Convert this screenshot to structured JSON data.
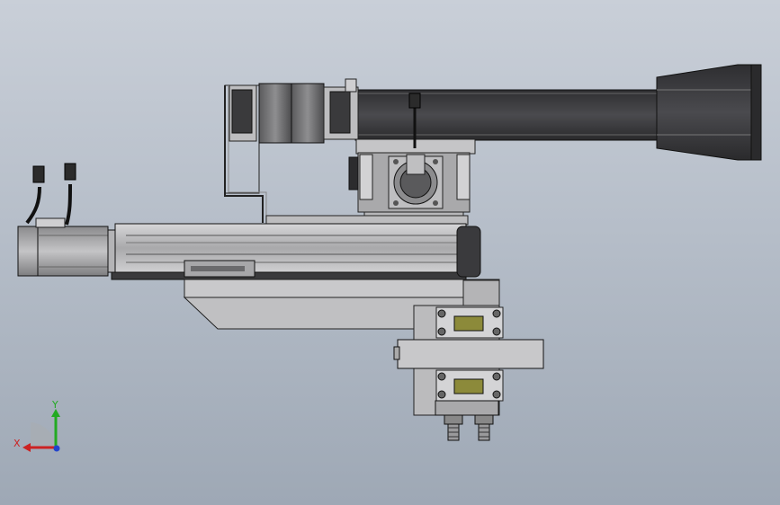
{
  "viewport": {
    "background_top": "#c9cfd8",
    "background_bottom": "#9ea8b5"
  },
  "colors": {
    "dark_beam": "#3a3a3d",
    "light_metal": "#c9c9cb",
    "mid_metal": "#9a9a9c",
    "outline": "#1a1a1a",
    "brass": "#8c8a3a",
    "cable": "#111111"
  },
  "parts": [
    "servo-motor-left",
    "linear-module-horizontal",
    "upper-beam-arm",
    "stepper-motor-top",
    "rotary-motor",
    "carriage-bracket",
    "vertical-slide-assembly",
    "gripper-fingers"
  ],
  "triad": {
    "x_label": "X",
    "y_label": "Y",
    "x_color": "#cc2222",
    "y_color": "#22aa22",
    "z_color": "#2244cc"
  }
}
